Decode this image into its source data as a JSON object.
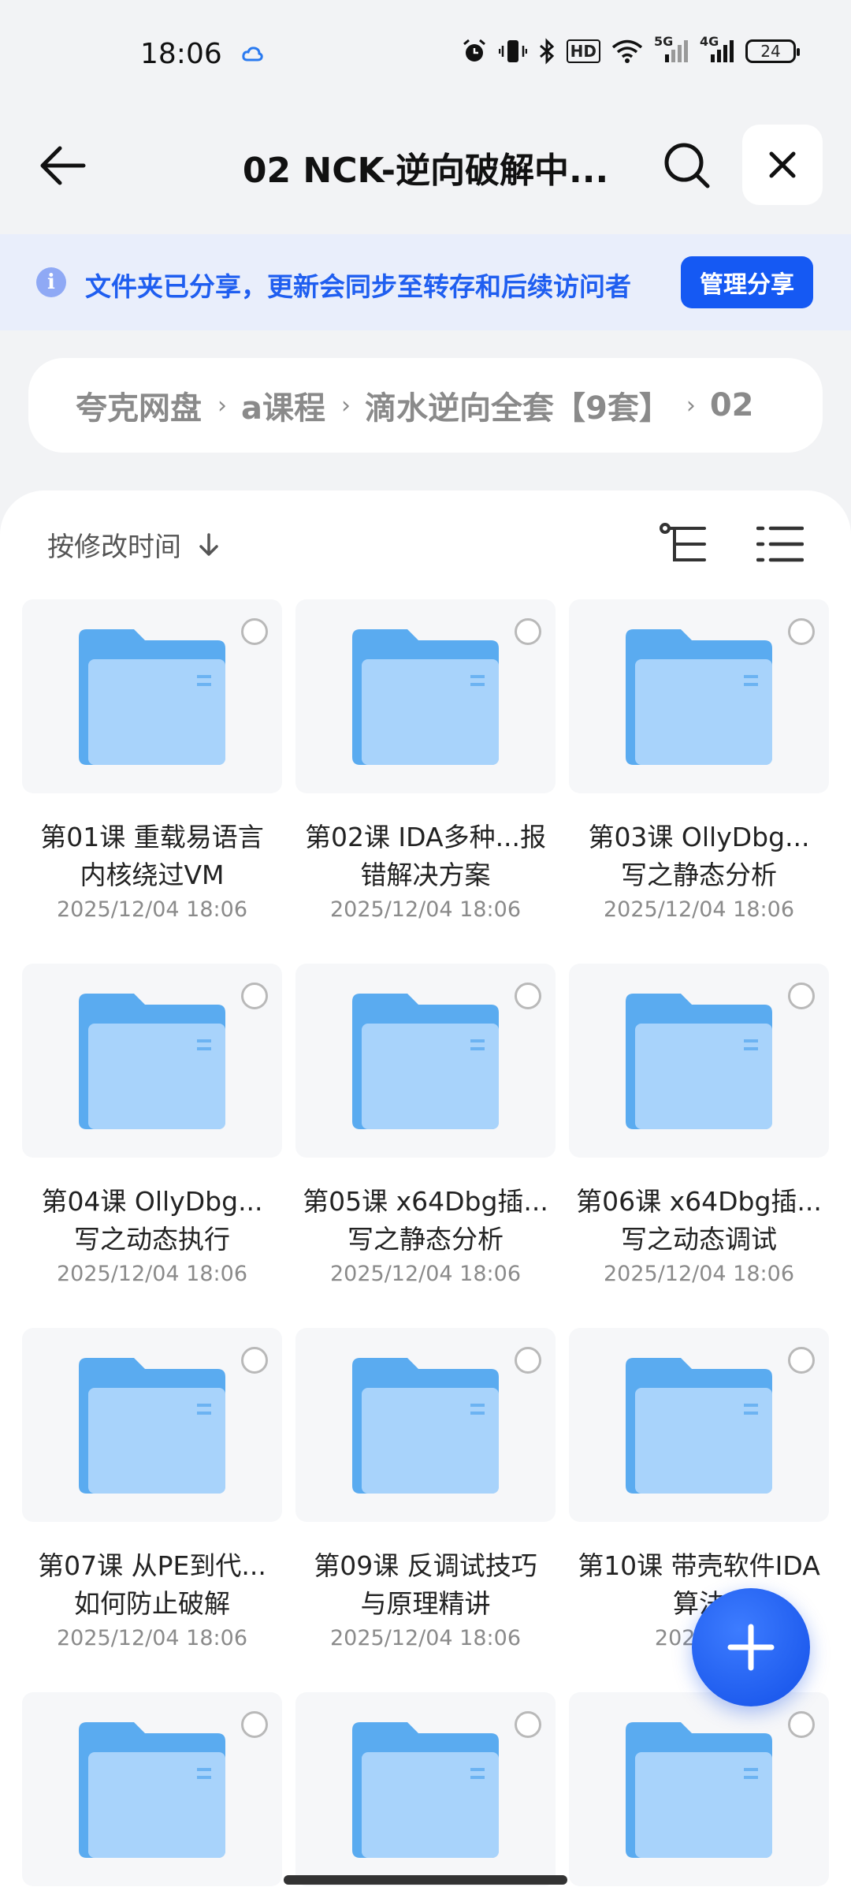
{
  "status_bar": {
    "time": "18:06",
    "network_5g": "5G",
    "network_4g": "4G",
    "hd_label": "HD",
    "battery": "24",
    "icons": [
      "alarm-icon",
      "vibrate-icon",
      "bluetooth-icon",
      "hd-icon",
      "wifi-icon",
      "signal-5g-icon",
      "signal-4g-icon",
      "battery-icon"
    ]
  },
  "header": {
    "title": "02 NCK-逆向破解中..."
  },
  "banner": {
    "text": "文件夹已分享，更新会同步至转存和后续访问者",
    "button_label": "管理分享"
  },
  "breadcrumb": [
    "夸克网盘",
    "a课程",
    "滴水逆向全套【9套】",
    "02"
  ],
  "sort": {
    "label": "按修改时间"
  },
  "folders": [
    {
      "name": "第01课 重载易语言内核绕过VM",
      "date": "2025/12/04 18:06"
    },
    {
      "name": "第02课 IDA多种...报错解决方案",
      "date": "2025/12/04 18:06"
    },
    {
      "name": "第03课 OllyDbg...写之静态分析",
      "date": "2025/12/04 18:06"
    },
    {
      "name": "第04课 OllyDbg...写之动态执行",
      "date": "2025/12/04 18:06"
    },
    {
      "name": "第05课 x64Dbg插...写之静态分析",
      "date": "2025/12/04 18:06"
    },
    {
      "name": "第06课 x64Dbg插...写之动态调试",
      "date": "2025/12/04 18:06"
    },
    {
      "name": "第07课 从PE到代...如何防止破解",
      "date": "2025/12/04 18:06"
    },
    {
      "name": "第09课 反调试技巧与原理精讲",
      "date": "2025/12/04 18:06"
    },
    {
      "name": "第10课 带壳软件IDA算法",
      "date": "2025/12"
    },
    {
      "name": "",
      "date": ""
    },
    {
      "name": "",
      "date": ""
    },
    {
      "name": "",
      "date": ""
    }
  ],
  "colors": {
    "accent": "#1559f3",
    "banner_bg": "#e9eefb",
    "folder_blue": "#5aabf0"
  }
}
